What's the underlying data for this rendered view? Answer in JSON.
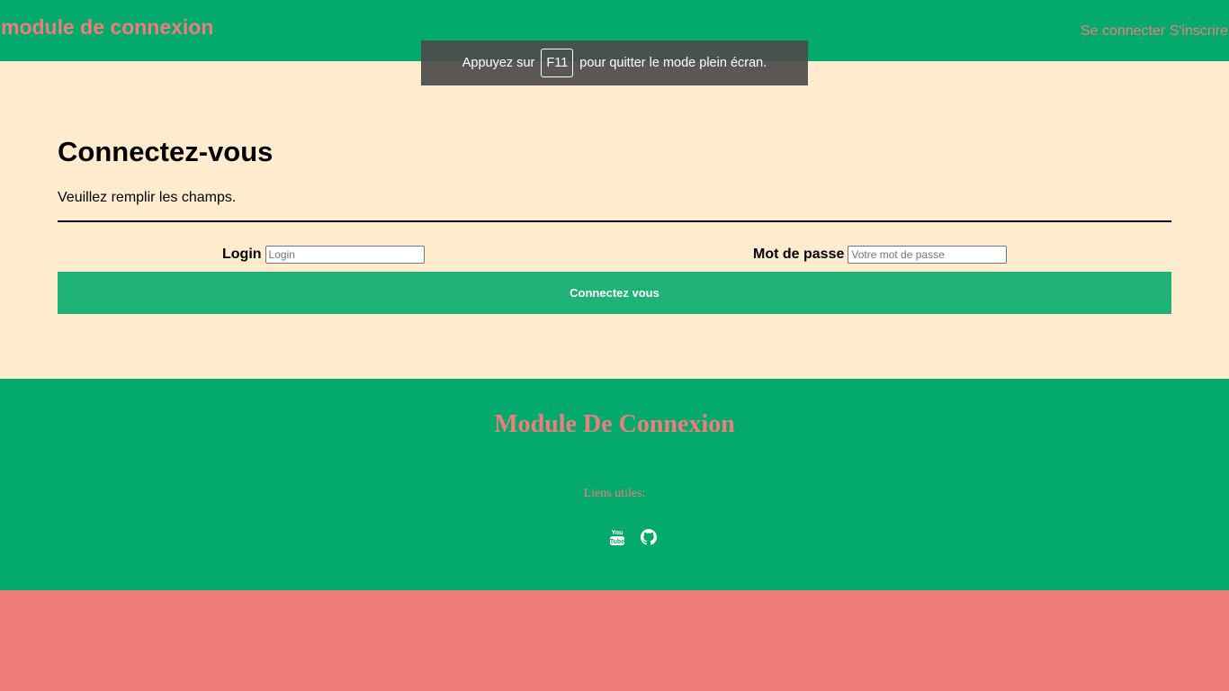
{
  "colors": {
    "header_bg": "#04aa6d",
    "accent": "#ef7d7b",
    "main_bg": "#ffebcd",
    "button_bg": "#1fb278"
  },
  "header": {
    "title": "module de connexion",
    "nav": {
      "login_label": "Se connecter",
      "signup_label": "S'inscrire"
    }
  },
  "fullscreen_toast": {
    "before": "Appuyez sur",
    "key": "F11",
    "after": "pour quitter le mode plein écran."
  },
  "main": {
    "heading": "Connectez-vous",
    "subtitle": "Veuillez remplir les champs.",
    "login": {
      "label": "Login",
      "placeholder": "Login",
      "value": ""
    },
    "password": {
      "label": "Mot de passe",
      "placeholder": "Votre mot de passe",
      "value": ""
    },
    "submit_label": "Connectez vous"
  },
  "footer": {
    "title": "Module De Connexion",
    "links_label": "Liens utiles:",
    "social_icons": [
      "youtube-icon",
      "github-icon"
    ]
  }
}
